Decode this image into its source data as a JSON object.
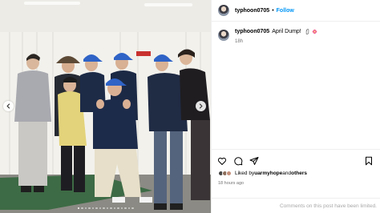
{
  "header": {
    "username": "typhoon0705",
    "separator": "•",
    "follow_label": "Follow"
  },
  "caption": {
    "username": "typhoon0705",
    "text": "April Dump!",
    "time": "18h"
  },
  "likes": {
    "prefix": "Liked by ",
    "user": "uarmyhope",
    "conjunction": " and ",
    "others": "others"
  },
  "post_time": "18 hours ago",
  "comments_notice": "Comments on this post have been limited.",
  "carousel": {
    "slide_count": 16,
    "active_index": 0
  },
  "icons": {
    "like": "heart-icon",
    "comment": "comment-icon",
    "share": "send-icon",
    "save": "bookmark-icon",
    "prev": "chevron-left-icon",
    "next": "chevron-right-icon"
  },
  "colors": {
    "follow": "#0095f6",
    "secondary_text": "#737373",
    "muted_text": "#a8a8a8",
    "divider": "#efefef"
  }
}
